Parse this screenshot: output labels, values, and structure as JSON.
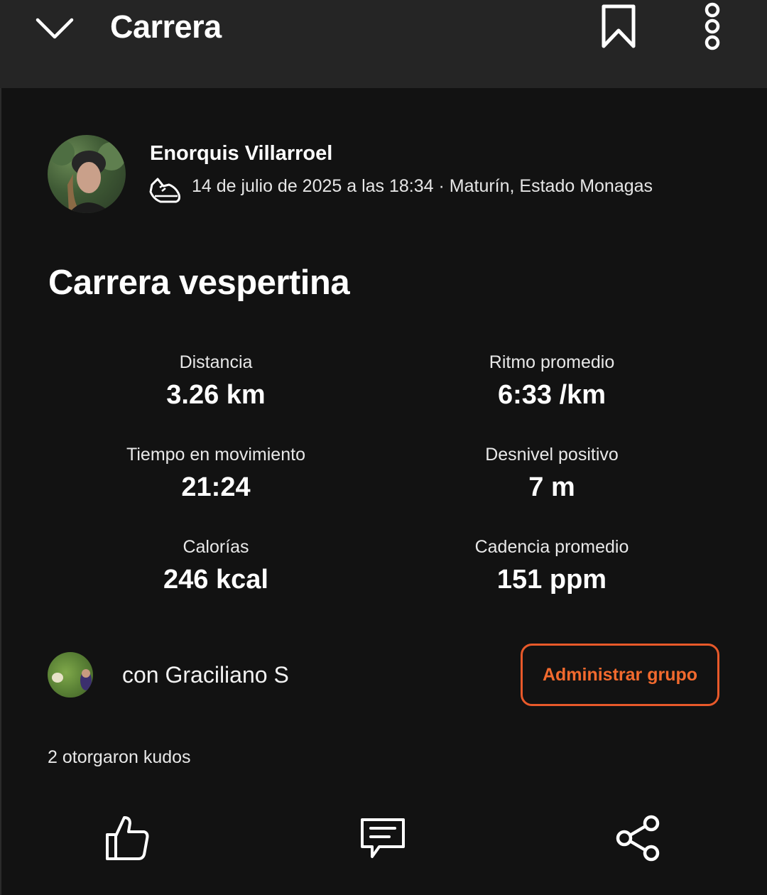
{
  "header": {
    "title": "Carrera",
    "back_icon": "chevron-down-icon",
    "bookmark_icon": "bookmark-icon",
    "more_icon": "more-vertical-icon"
  },
  "athlete": {
    "name": "Enorquis Villarroel",
    "activity_icon": "running-shoe-icon",
    "meta": "14 de julio de 2025 a las 18:34 · Maturín, Estado Monagas"
  },
  "activity": {
    "title": "Carrera vespertina"
  },
  "stats": [
    {
      "label": "Distancia",
      "value": "3.26 km"
    },
    {
      "label": "Ritmo promedio",
      "value": "6:33 /km"
    },
    {
      "label": "Tiempo en movimiento",
      "value": "21:24"
    },
    {
      "label": "Desnivel positivo",
      "value": "7 m"
    },
    {
      "label": "Calorías",
      "value": "246 kcal"
    },
    {
      "label": "Cadencia promedio",
      "value": "151 ppm"
    }
  ],
  "group": {
    "text": "con Graciliano S",
    "manage_label": "Administrar grupo"
  },
  "kudos": {
    "text": "2 otorgaron kudos"
  },
  "actions": {
    "kudos_icon": "thumbs-up-icon",
    "comment_icon": "comment-icon",
    "share_icon": "share-icon"
  },
  "colors": {
    "accent": "#f26a2e",
    "background": "#121212",
    "header_background": "#252525"
  }
}
